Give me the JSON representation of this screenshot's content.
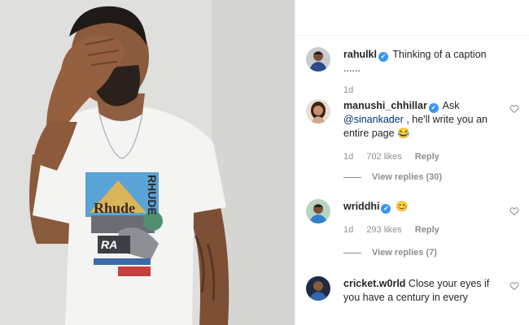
{
  "post": {
    "author": "rahulkl",
    "caption": "Thinking of a caption ......",
    "time": "1d"
  },
  "comments": [
    {
      "user": "manushi_chhillar",
      "text_before": "Ask",
      "mention": "@sinankader",
      "text_after": ", he'll write you an entire page 😂",
      "time": "1d",
      "likes": "702 likes",
      "reply": "Reply",
      "view_replies": "View replies (30)"
    },
    {
      "user": "wriddhi",
      "text": "😊",
      "time": "1d",
      "likes": "293 likes",
      "reply": "Reply",
      "view_replies": "View replies (7)"
    },
    {
      "user": "cricket.w0rld",
      "text": "Close your eyes if you have a century in every"
    }
  ],
  "shirt_graphic": {
    "text_1": "RHUDE",
    "text_2": "Rhude"
  },
  "colors": {
    "verified": "#3897f0",
    "mention": "#003569",
    "meta": "#8e8e8e"
  }
}
